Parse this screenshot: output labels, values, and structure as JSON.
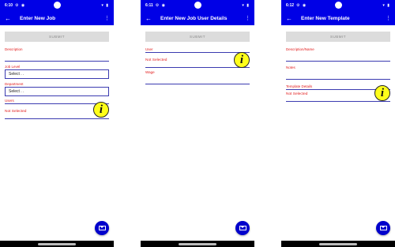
{
  "screens": [
    {
      "status": {
        "time": "6:10",
        "icons": "⚙ ◉",
        "right": "▾ ▮"
      },
      "appbar": {
        "back": "←",
        "title": "Enter New Job",
        "menu": "⋮"
      },
      "submit": "SUBMIT",
      "fields": {
        "description": "Description",
        "job_level": "Job Level",
        "job_level_value": "Select . .",
        "department": "Department",
        "department_value": "Select . .",
        "users": "Users",
        "users_value": "Not Selected"
      },
      "info_glyph": "i",
      "fab_icon": "envelope-icon"
    },
    {
      "status": {
        "time": "6:11",
        "icons": "⚙ ◉",
        "right": "▾ ▮"
      },
      "appbar": {
        "back": "←",
        "title": "Enter New Job User Details",
        "menu": "⋮"
      },
      "submit": "SUBMIT",
      "fields": {
        "user": "User",
        "user_value": "Not Selected",
        "wage": "Wage"
      },
      "info_glyph": "i",
      "fab_icon": "envelope-icon"
    },
    {
      "status": {
        "time": "6:12",
        "icons": "⚙ ◉",
        "right": "▾ ▮"
      },
      "appbar": {
        "back": "←",
        "title": "Enter New Template",
        "menu": "⋮"
      },
      "submit": "SUBMIT",
      "fields": {
        "description_name": "Description/Name",
        "notes": "Notes",
        "template_details": "Template Details",
        "template_value": "Not Selected"
      },
      "info_glyph": "i",
      "fab_icon": "envelope-icon"
    }
  ],
  "colors": {
    "primary": "#0000e6",
    "accent_text": "#e21b1b",
    "info": "#ffff1a",
    "submit_bg": "#dcdcdc"
  }
}
